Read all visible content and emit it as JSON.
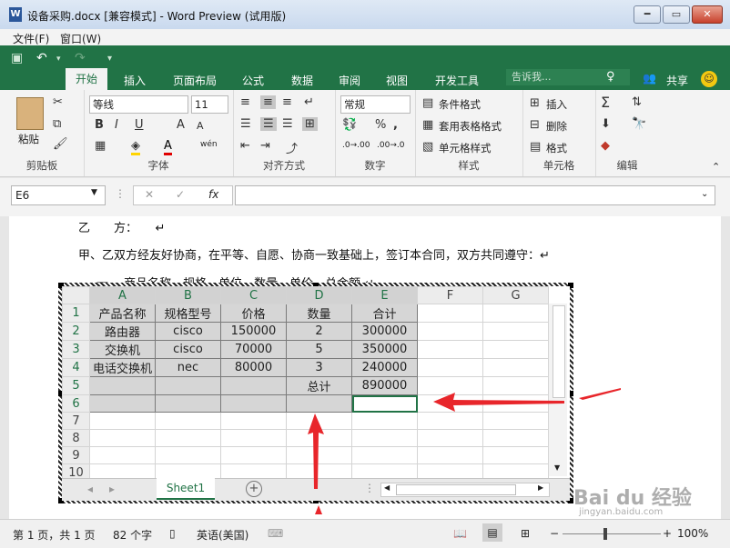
{
  "window": {
    "title": "设备采购.docx [兼容模式] - Word Preview (试用版)",
    "minimize": "━",
    "maximize": "▭",
    "close": "✕"
  },
  "menu": [
    "文件(F)",
    "窗口(W)"
  ],
  "ribbon": {
    "tabs": [
      "开始",
      "插入",
      "页面布局",
      "公式",
      "数据",
      "审阅",
      "视图",
      "开发工具"
    ],
    "tell_me": "告诉我...",
    "share": "共享",
    "clipboard": {
      "paste": "粘贴",
      "label": "剪贴板"
    },
    "font": {
      "name": "等线",
      "size": "11",
      "label": "字体",
      "grow": "A",
      "shrink": "A",
      "bold": "B",
      "italic": "I",
      "underline": "U",
      "phonetic": "wén"
    },
    "alignment": {
      "label": "对齐方式"
    },
    "number": {
      "format": "常规",
      "label": "数字",
      "percent": "%",
      "comma": ","
    },
    "styles": {
      "items": [
        "条件格式",
        "套用表格格式",
        "单元格样式"
      ],
      "label": "样式"
    },
    "cells": {
      "items": [
        "插入",
        "删除",
        "格式"
      ],
      "label": "单元格"
    },
    "editing": {
      "label": "编辑",
      "sum": "Σ"
    }
  },
  "formula_bar": {
    "namebox": "E6",
    "fx": "fx",
    "value": ""
  },
  "document": {
    "lines": [
      "乙　　方：　　↵",
      "甲、乙双方经友好协商，在平等、自愿、协商一致基础上，签订本合同，双方共同遵守：↵",
      "一、 商品名称、规格、单位、数量、单价、总金额 ↵"
    ]
  },
  "sheet": {
    "columns": [
      "A",
      "B",
      "C",
      "D",
      "E",
      "F",
      "G"
    ],
    "rows": [
      [
        "产品名称",
        "规格型号",
        "价格",
        "数量",
        "合计",
        "",
        ""
      ],
      [
        "路由器",
        "cisco",
        "150000",
        "2",
        "300000",
        "",
        ""
      ],
      [
        "交换机",
        "cisco",
        "70000",
        "5",
        "350000",
        "",
        ""
      ],
      [
        "电话交换机",
        "nec",
        "80000",
        "3",
        "240000",
        "",
        ""
      ],
      [
        "",
        "",
        "",
        "总计",
        "890000",
        "",
        ""
      ],
      [
        "",
        "",
        "",
        "",
        "",
        "",
        ""
      ],
      [
        "",
        "",
        "",
        "",
        "",
        "",
        ""
      ],
      [
        "",
        "",
        "",
        "",
        "",
        "",
        ""
      ],
      [
        "",
        "",
        "",
        "",
        "",
        "",
        ""
      ],
      [
        "",
        "",
        "",
        "",
        "",
        "",
        ""
      ]
    ],
    "row_numbers": [
      "1",
      "2",
      "3",
      "4",
      "5",
      "6",
      "7",
      "8",
      "9",
      "10"
    ],
    "tab": "Sheet1"
  },
  "status": {
    "page": "第 1 页，共 1 页",
    "words": "82 个字",
    "language": "英语(美国)",
    "zoom": "100%",
    "zoom_level": 1.0
  },
  "watermark": {
    "text": "Bai du 经验",
    "sub": "jingyan.baidu.com"
  },
  "colors": {
    "accent": "#217346",
    "arrow": "#e8262b"
  }
}
